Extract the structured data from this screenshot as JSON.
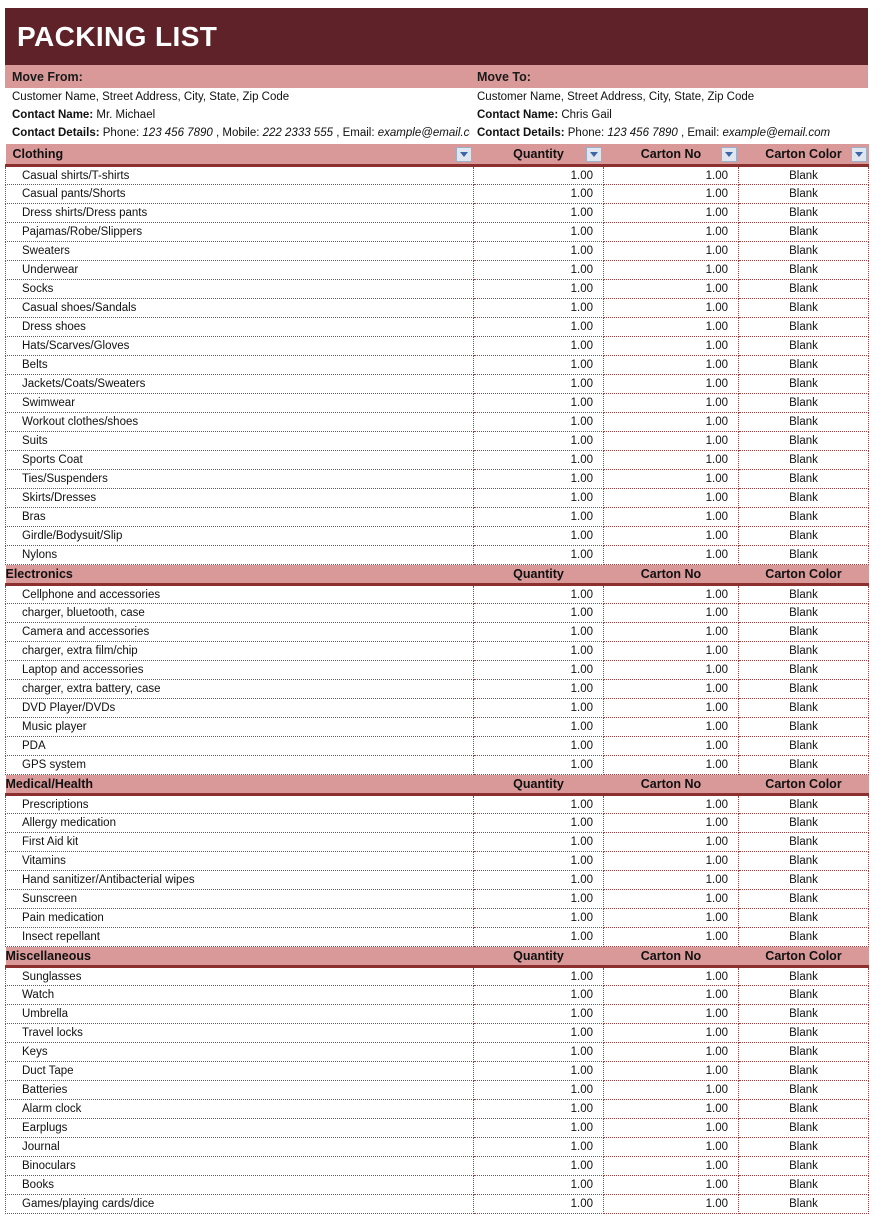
{
  "title": "PACKING LIST",
  "move_from": {
    "heading": "Move From:",
    "address": "Customer Name, Street Address, City, State, Zip Code",
    "contact_name_label": "Contact Name:",
    "contact_name": "Mr. Michael",
    "contact_details_label": "Contact Details:",
    "phone_label": "Phone:",
    "phone": "123 456 7890",
    "mobile_sep": ", Mobile:",
    "mobile": "222 2333 555",
    "email_sep": ", Email:",
    "email": "example@email.com"
  },
  "move_to": {
    "heading": "Move To:",
    "address": "Customer Name, Street Address, City, State, Zip Code",
    "contact_name_label": "Contact Name:",
    "contact_name": "Chris Gail",
    "contact_details_label": "Contact Details:",
    "phone_label": "Phone:",
    "phone": "123 456 7890",
    "email_sep": ", Email:",
    "email": "example@email.com"
  },
  "columns": {
    "quantity": "Quantity",
    "carton_no": "Carton No",
    "carton_color": "Carton Color"
  },
  "defaults": {
    "quantity": "1.00",
    "carton_no": "1.00",
    "carton_color": "Blank"
  },
  "colors": {
    "title_band": "#5E2228",
    "section_band": "#D99999",
    "section_border": "#8C2F2F",
    "grid_line": "#A04040",
    "filter_arrow": "#3D66A8",
    "filter_button_bg": "#DFE6EF"
  },
  "sections": [
    {
      "name": "Clothing",
      "has_filters": true,
      "items": [
        {
          "name": "Casual shirts/T-shirts",
          "quantity": "1.00",
          "carton_no": "1.00",
          "carton_color": "Blank"
        },
        {
          "name": "Casual pants/Shorts",
          "quantity": "1.00",
          "carton_no": "1.00",
          "carton_color": "Blank"
        },
        {
          "name": "Dress shirts/Dress pants",
          "quantity": "1.00",
          "carton_no": "1.00",
          "carton_color": "Blank"
        },
        {
          "name": "Pajamas/Robe/Slippers",
          "quantity": "1.00",
          "carton_no": "1.00",
          "carton_color": "Blank"
        },
        {
          "name": "Sweaters",
          "quantity": "1.00",
          "carton_no": "1.00",
          "carton_color": "Blank"
        },
        {
          "name": "Underwear",
          "quantity": "1.00",
          "carton_no": "1.00",
          "carton_color": "Blank"
        },
        {
          "name": "Socks",
          "quantity": "1.00",
          "carton_no": "1.00",
          "carton_color": "Blank"
        },
        {
          "name": "Casual shoes/Sandals",
          "quantity": "1.00",
          "carton_no": "1.00",
          "carton_color": "Blank"
        },
        {
          "name": "Dress shoes",
          "quantity": "1.00",
          "carton_no": "1.00",
          "carton_color": "Blank"
        },
        {
          "name": "Hats/Scarves/Gloves",
          "quantity": "1.00",
          "carton_no": "1.00",
          "carton_color": "Blank"
        },
        {
          "name": "Belts",
          "quantity": "1.00",
          "carton_no": "1.00",
          "carton_color": "Blank"
        },
        {
          "name": "Jackets/Coats/Sweaters",
          "quantity": "1.00",
          "carton_no": "1.00",
          "carton_color": "Blank"
        },
        {
          "name": "Swimwear",
          "quantity": "1.00",
          "carton_no": "1.00",
          "carton_color": "Blank"
        },
        {
          "name": "Workout clothes/shoes",
          "quantity": "1.00",
          "carton_no": "1.00",
          "carton_color": "Blank"
        },
        {
          "name": "Suits",
          "quantity": "1.00",
          "carton_no": "1.00",
          "carton_color": "Blank"
        },
        {
          "name": "Sports Coat",
          "quantity": "1.00",
          "carton_no": "1.00",
          "carton_color": "Blank"
        },
        {
          "name": "Ties/Suspenders",
          "quantity": "1.00",
          "carton_no": "1.00",
          "carton_color": "Blank"
        },
        {
          "name": "Skirts/Dresses",
          "quantity": "1.00",
          "carton_no": "1.00",
          "carton_color": "Blank"
        },
        {
          "name": "Bras",
          "quantity": "1.00",
          "carton_no": "1.00",
          "carton_color": "Blank"
        },
        {
          "name": "Girdle/Bodysuit/Slip",
          "quantity": "1.00",
          "carton_no": "1.00",
          "carton_color": "Blank"
        },
        {
          "name": "Nylons",
          "quantity": "1.00",
          "carton_no": "1.00",
          "carton_color": "Blank"
        }
      ]
    },
    {
      "name": "Electronics",
      "has_filters": false,
      "items": [
        {
          "name": "Cellphone and accessories",
          "quantity": "1.00",
          "carton_no": "1.00",
          "carton_color": "Blank"
        },
        {
          "name": "charger, bluetooth, case",
          "quantity": "1.00",
          "carton_no": "1.00",
          "carton_color": "Blank"
        },
        {
          "name": "Camera and accessories",
          "quantity": "1.00",
          "carton_no": "1.00",
          "carton_color": "Blank"
        },
        {
          "name": "charger, extra film/chip",
          "quantity": "1.00",
          "carton_no": "1.00",
          "carton_color": "Blank"
        },
        {
          "name": "Laptop and accessories",
          "quantity": "1.00",
          "carton_no": "1.00",
          "carton_color": "Blank"
        },
        {
          "name": "charger, extra battery, case",
          "quantity": "1.00",
          "carton_no": "1.00",
          "carton_color": "Blank"
        },
        {
          "name": "DVD Player/DVDs",
          "quantity": "1.00",
          "carton_no": "1.00",
          "carton_color": "Blank"
        },
        {
          "name": "Music player",
          "quantity": "1.00",
          "carton_no": "1.00",
          "carton_color": "Blank"
        },
        {
          "name": "PDA",
          "quantity": "1.00",
          "carton_no": "1.00",
          "carton_color": "Blank"
        },
        {
          "name": "GPS system",
          "quantity": "1.00",
          "carton_no": "1.00",
          "carton_color": "Blank"
        }
      ]
    },
    {
      "name": "Medical/Health",
      "has_filters": false,
      "items": [
        {
          "name": "Prescriptions",
          "quantity": "1.00",
          "carton_no": "1.00",
          "carton_color": "Blank"
        },
        {
          "name": "Allergy medication",
          "quantity": "1.00",
          "carton_no": "1.00",
          "carton_color": "Blank"
        },
        {
          "name": "First Aid kit",
          "quantity": "1.00",
          "carton_no": "1.00",
          "carton_color": "Blank"
        },
        {
          "name": "Vitamins",
          "quantity": "1.00",
          "carton_no": "1.00",
          "carton_color": "Blank"
        },
        {
          "name": "Hand sanitizer/Antibacterial wipes",
          "quantity": "1.00",
          "carton_no": "1.00",
          "carton_color": "Blank"
        },
        {
          "name": "Sunscreen",
          "quantity": "1.00",
          "carton_no": "1.00",
          "carton_color": "Blank"
        },
        {
          "name": "Pain medication",
          "quantity": "1.00",
          "carton_no": "1.00",
          "carton_color": "Blank"
        },
        {
          "name": "Insect repellant",
          "quantity": "1.00",
          "carton_no": "1.00",
          "carton_color": "Blank"
        }
      ]
    },
    {
      "name": "Miscellaneous",
      "has_filters": false,
      "items": [
        {
          "name": "Sunglasses",
          "quantity": "1.00",
          "carton_no": "1.00",
          "carton_color": "Blank"
        },
        {
          "name": "Watch",
          "quantity": "1.00",
          "carton_no": "1.00",
          "carton_color": "Blank"
        },
        {
          "name": "Umbrella",
          "quantity": "1.00",
          "carton_no": "1.00",
          "carton_color": "Blank"
        },
        {
          "name": "Travel locks",
          "quantity": "1.00",
          "carton_no": "1.00",
          "carton_color": "Blank"
        },
        {
          "name": "Keys",
          "quantity": "1.00",
          "carton_no": "1.00",
          "carton_color": "Blank"
        },
        {
          "name": "Duct Tape",
          "quantity": "1.00",
          "carton_no": "1.00",
          "carton_color": "Blank"
        },
        {
          "name": "Batteries",
          "quantity": "1.00",
          "carton_no": "1.00",
          "carton_color": "Blank"
        },
        {
          "name": "Alarm clock",
          "quantity": "1.00",
          "carton_no": "1.00",
          "carton_color": "Blank"
        },
        {
          "name": "Earplugs",
          "quantity": "1.00",
          "carton_no": "1.00",
          "carton_color": "Blank"
        },
        {
          "name": "Journal",
          "quantity": "1.00",
          "carton_no": "1.00",
          "carton_color": "Blank"
        },
        {
          "name": "Binoculars",
          "quantity": "1.00",
          "carton_no": "1.00",
          "carton_color": "Blank"
        },
        {
          "name": "Books",
          "quantity": "1.00",
          "carton_no": "1.00",
          "carton_color": "Blank"
        },
        {
          "name": "Games/playing cards/dice",
          "quantity": "1.00",
          "carton_no": "1.00",
          "carton_color": "Blank"
        }
      ]
    }
  ]
}
